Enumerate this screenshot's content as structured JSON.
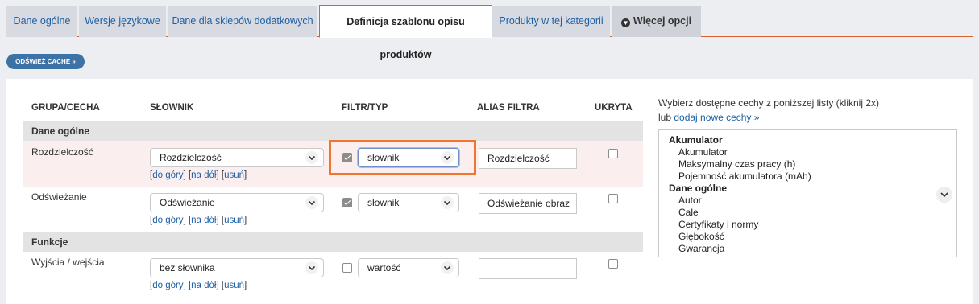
{
  "tabs": [
    {
      "label": "Dane ogólne"
    },
    {
      "label": "Wersje językowe"
    },
    {
      "label": "Dane dla sklepów dodatkowych"
    },
    {
      "label": "Definicja szablonu opisu produktów"
    },
    {
      "label": "Produkty w tej kategorii"
    },
    {
      "label": "Więcej opcji"
    }
  ],
  "cache_button": "ODŚWIEŻ CACHE »",
  "table": {
    "headers": {
      "group": "GRUPA/CECHA",
      "dictionary": "SŁOWNIK",
      "filter": "FILTR/TYP",
      "alias": "ALIAS FILTRA",
      "hidden": "UKRYTA"
    },
    "groups": [
      {
        "name": "Dane ogólne"
      },
      {
        "name": "Funkcje"
      }
    ],
    "rows": [
      {
        "name": "Rozdzielczość",
        "dictionary": "Rozdzielczość",
        "filter_checked": true,
        "type": "słownik",
        "alias": "Rozdzielczość",
        "hidden": false
      },
      {
        "name": "Odświeżanie",
        "dictionary": "Odświeżanie",
        "filter_checked": true,
        "type": "słownik",
        "alias": "Odświeżanie obraz",
        "hidden": false
      },
      {
        "name": "Wyjścia / wejścia",
        "dictionary": "bez słownika",
        "filter_checked": false,
        "type": "wartość",
        "alias": "",
        "hidden": false
      }
    ],
    "links": {
      "up": "do góry",
      "down": "na dół",
      "delete": "usuń"
    }
  },
  "side": {
    "line1": "Wybierz dostępne cechy z poniższej listy (kliknij 2x)",
    "line2_prefix": "lub",
    "add_link": "dodaj nowe cechy »",
    "list": [
      {
        "group": "Akumulator",
        "items": [
          "Akumulator",
          "Maksymalny czas pracy (h)",
          "Pojemność akumulatora (mAh)"
        ]
      },
      {
        "group": "Dane ogólne",
        "items": [
          "Autor",
          "Cale",
          "Certyfikaty i normy",
          "Głębokość",
          "Gwarancja"
        ]
      }
    ]
  },
  "colors": {
    "accent": "#ef7630",
    "link": "#1d5fa5",
    "button": "#3d72a6"
  },
  "icons": {
    "chevron": "chevron-down-icon",
    "more": "circle-arrow-down-icon"
  }
}
